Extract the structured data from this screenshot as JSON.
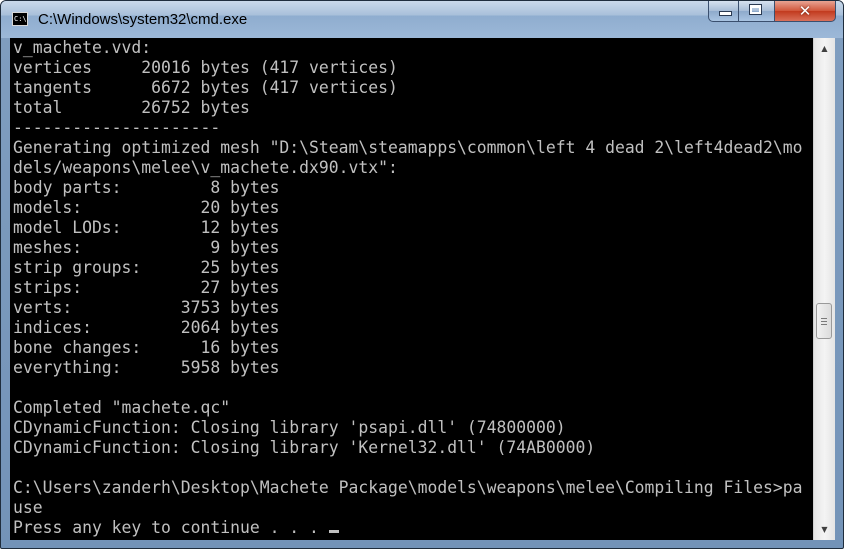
{
  "window": {
    "title": "C:\\Windows\\system32\\cmd.exe",
    "icon": "cmd-icon",
    "icon_text": "C:\\",
    "controls": {
      "minimize": "minimize-icon",
      "maximize": "maximize-icon",
      "close": "close-icon",
      "close_color": "#c7452a"
    }
  },
  "console": {
    "background": "#000000",
    "foreground": "#c0c0c0",
    "lines": [
      "v_machete.vvd:",
      "vertices     20016 bytes (417 vertices)",
      "tangents      6672 bytes (417 vertices)",
      "total        26752 bytes",
      "---------------------",
      "Generating optimized mesh \"D:\\Steam\\steamapps\\common\\left 4 dead 2\\left4dead2\\mo",
      "dels/weapons\\melee\\v_machete.dx90.vtx\":",
      "body parts:         8 bytes",
      "models:            20 bytes",
      "model LODs:        12 bytes",
      "meshes:             9 bytes",
      "strip groups:      25 bytes",
      "strips:            27 bytes",
      "verts:           3753 bytes",
      "indices:         2064 bytes",
      "bone changes:      16 bytes",
      "everything:      5958 bytes",
      "",
      "Completed \"machete.qc\"",
      "CDynamicFunction: Closing library 'psapi.dll' (74800000)",
      "CDynamicFunction: Closing library 'Kernel32.dll' (74AB0000)",
      "",
      "C:\\Users\\zanderh\\Desktop\\Machete Package\\models\\weapons\\melee\\Compiling Files>pa",
      "use",
      "Press any key to continue . . . "
    ]
  },
  "scrollbar": {
    "up_icon": "scroll-up-arrow-icon",
    "down_icon": "scroll-down-arrow-icon"
  }
}
